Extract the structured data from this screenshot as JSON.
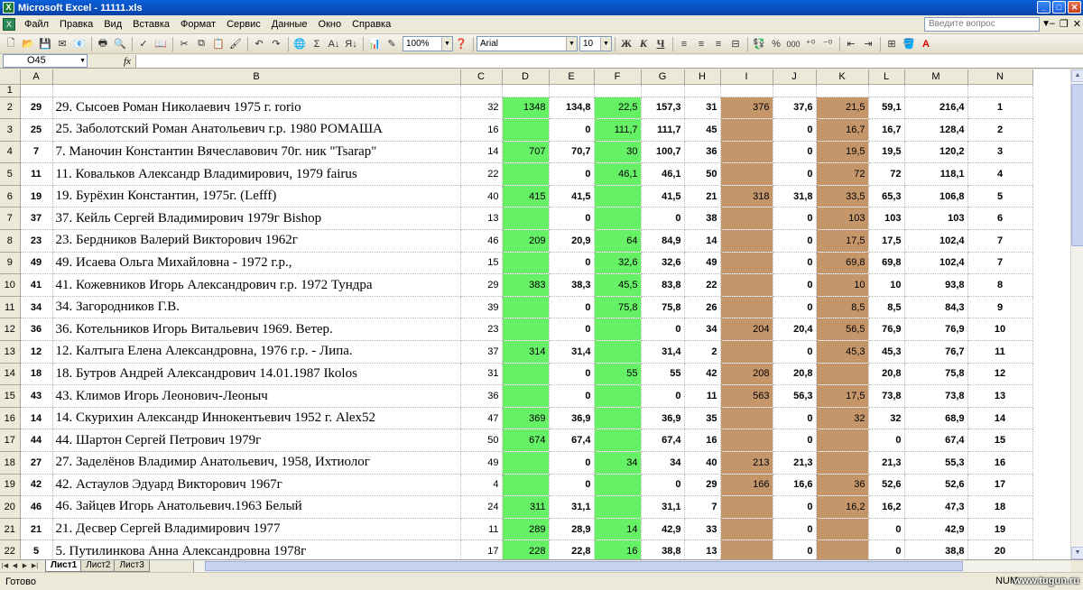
{
  "window": {
    "title": "Microsoft Excel - 11111.xls",
    "app_icon": "X"
  },
  "menu": {
    "items": [
      "Файл",
      "Правка",
      "Вид",
      "Вставка",
      "Формат",
      "Сервис",
      "Данные",
      "Окно",
      "Справка"
    ],
    "help_placeholder": "Введите вопрос"
  },
  "toolbar": {
    "zoom": "100%",
    "font": "Arial",
    "font_size": "10",
    "bold": "Ж",
    "italic": "К",
    "underline": "Ч",
    "percent": "%",
    "thousands": "000",
    "sum": "Σ"
  },
  "formula_bar": {
    "name_box": "O45",
    "fx": "fx",
    "content": ""
  },
  "columns": [
    "A",
    "B",
    "C",
    "D",
    "E",
    "F",
    "G",
    "H",
    "I",
    "J",
    "K",
    "L",
    "M",
    "N"
  ],
  "rows": [
    {
      "n": "1",
      "a": "",
      "b": "",
      "c": "",
      "d": "",
      "e": "",
      "f": "",
      "g": "",
      "h": "",
      "i": "",
      "j": "",
      "k": "",
      "l": "",
      "m": "",
      "nn": ""
    },
    {
      "n": "2",
      "a": "29",
      "b": "29. Сысоев Роман Николаевич 1975 г. rorio",
      "c": "32",
      "d": "1348",
      "e": "134,8",
      "f": "22,5",
      "g": "157,3",
      "h": "31",
      "i": "376",
      "j": "37,6",
      "k": "21,5",
      "l": "59,1",
      "m": "216,4",
      "nn": "1"
    },
    {
      "n": "3",
      "a": "25",
      "b": "25. Заболотский Роман Анатольевич г.р. 1980 РОМАША",
      "c": "16",
      "d": "",
      "e": "0",
      "f": "111,7",
      "g": "111,7",
      "h": "45",
      "i": "",
      "j": "0",
      "k": "16,7",
      "l": "16,7",
      "m": "128,4",
      "nn": "2"
    },
    {
      "n": "4",
      "a": "7",
      "b": "7. Маночин Константин Вячеславович 70г. ник \"Tsarap\"",
      "c": "14",
      "d": "707",
      "e": "70,7",
      "f": "30",
      "g": "100,7",
      "h": "36",
      "i": "",
      "j": "0",
      "k": "19,5",
      "l": "19,5",
      "m": "120,2",
      "nn": "3"
    },
    {
      "n": "5",
      "a": "11",
      "b": "11. Ковальков Александр Владимирович, 1979 fairus",
      "c": "22",
      "d": "",
      "e": "0",
      "f": "46,1",
      "g": "46,1",
      "h": "50",
      "i": "",
      "j": "0",
      "k": "72",
      "l": "72",
      "m": "118,1",
      "nn": "4"
    },
    {
      "n": "6",
      "a": "19",
      "b": "19. Бурёхин Константин, 1975г. (Lefff)",
      "c": "40",
      "d": "415",
      "e": "41,5",
      "f": "",
      "g": "41,5",
      "h": "21",
      "i": "318",
      "j": "31,8",
      "k": "33,5",
      "l": "65,3",
      "m": "106,8",
      "nn": "5"
    },
    {
      "n": "7",
      "a": "37",
      "b": "37. Кейль Сергей Владимирович 1979г Bishop",
      "c": "13",
      "d": "",
      "e": "0",
      "f": "",
      "g": "0",
      "h": "38",
      "i": "",
      "j": "0",
      "k": "103",
      "l": "103",
      "m": "103",
      "nn": "6"
    },
    {
      "n": "8",
      "a": "23",
      "b": "23. Бердников Валерий Викторович 1962г",
      "c": "46",
      "d": "209",
      "e": "20,9",
      "f": "64",
      "g": "84,9",
      "h": "14",
      "i": "",
      "j": "0",
      "k": "17,5",
      "l": "17,5",
      "m": "102,4",
      "nn": "7"
    },
    {
      "n": "9",
      "a": "49",
      "b": "49. Исаева Ольга Михайловна - 1972 г.р.,",
      "c": "15",
      "d": "",
      "e": "0",
      "f": "32,6",
      "g": "32,6",
      "h": "49",
      "i": "",
      "j": "0",
      "k": "69,8",
      "l": "69,8",
      "m": "102,4",
      "nn": "7"
    },
    {
      "n": "10",
      "a": "41",
      "b": "41. Кожевников Игорь Александрович г.р. 1972 Тундра",
      "c": "29",
      "d": "383",
      "e": "38,3",
      "f": "45,5",
      "g": "83,8",
      "h": "22",
      "i": "",
      "j": "0",
      "k": "10",
      "l": "10",
      "m": "93,8",
      "nn": "8"
    },
    {
      "n": "11",
      "a": "34",
      "b": "34. Загородников Г.В.",
      "c": "39",
      "d": "",
      "e": "0",
      "f": "75,8",
      "g": "75,8",
      "h": "26",
      "i": "",
      "j": "0",
      "k": "8,5",
      "l": "8,5",
      "m": "84,3",
      "nn": "9"
    },
    {
      "n": "12",
      "a": "36",
      "b": "36. Котельников Игорь Витальевич 1969. Ветер.",
      "c": "23",
      "d": "",
      "e": "0",
      "f": "",
      "g": "0",
      "h": "34",
      "i": "204",
      "j": "20,4",
      "k": "56,5",
      "l": "76,9",
      "m": "76,9",
      "nn": "10"
    },
    {
      "n": "13",
      "a": "12",
      "b": "12. Калтыга Елена Александровна, 1976 г.р. - Липа.",
      "c": "37",
      "d": "314",
      "e": "31,4",
      "f": "",
      "g": "31,4",
      "h": "2",
      "i": "",
      "j": "0",
      "k": "45,3",
      "l": "45,3",
      "m": "76,7",
      "nn": "11"
    },
    {
      "n": "14",
      "a": "18",
      "b": "18. Бутров Андрей Александрович 14.01.1987 Ikolos",
      "c": "31",
      "d": "",
      "e": "0",
      "f": "55",
      "g": "55",
      "h": "42",
      "i": "208",
      "j": "20,8",
      "k": "",
      "l": "20,8",
      "m": "75,8",
      "nn": "12"
    },
    {
      "n": "15",
      "a": "43",
      "b": "43. Климов Игорь Леонович-Леоныч",
      "c": "36",
      "d": "",
      "e": "0",
      "f": "",
      "g": "0",
      "h": "11",
      "i": "563",
      "j": "56,3",
      "k": "17,5",
      "l": "73,8",
      "m": "73,8",
      "nn": "13"
    },
    {
      "n": "16",
      "a": "14",
      "b": "14. Скурихин Александр Иннокентьевич 1952 г. Alex52",
      "c": "47",
      "d": "369",
      "e": "36,9",
      "f": "",
      "g": "36,9",
      "h": "35",
      "i": "",
      "j": "0",
      "k": "32",
      "l": "32",
      "m": "68,9",
      "nn": "14"
    },
    {
      "n": "17",
      "a": "44",
      "b": "44. Шартон Сергей Петрович 1979г",
      "c": "50",
      "d": "674",
      "e": "67,4",
      "f": "",
      "g": "67,4",
      "h": "16",
      "i": "",
      "j": "0",
      "k": "",
      "l": "0",
      "m": "67,4",
      "nn": "15"
    },
    {
      "n": "18",
      "a": "27",
      "b": "27. Заделёнов Владимир Анатольевич, 1958, Ихтиолог",
      "c": "49",
      "d": "",
      "e": "0",
      "f": "34",
      "g": "34",
      "h": "40",
      "i": "213",
      "j": "21,3",
      "k": "",
      "l": "21,3",
      "m": "55,3",
      "nn": "16"
    },
    {
      "n": "19",
      "a": "42",
      "b": "42. Астаулов Эдуард Викторович 1967г",
      "c": "4",
      "d": "",
      "e": "0",
      "f": "",
      "g": "0",
      "h": "29",
      "i": "166",
      "j": "16,6",
      "k": "36",
      "l": "52,6",
      "m": "52,6",
      "nn": "17"
    },
    {
      "n": "20",
      "a": "46",
      "b": "46. Зайцев Игорь Анатольевич.1963 Белый",
      "c": "24",
      "d": "311",
      "e": "31,1",
      "f": "",
      "g": "31,1",
      "h": "7",
      "i": "",
      "j": "0",
      "k": "16,2",
      "l": "16,2",
      "m": "47,3",
      "nn": "18"
    },
    {
      "n": "21",
      "a": "21",
      "b": "21. Десвер Сергей Владимирович 1977",
      "c": "11",
      "d": "289",
      "e": "28,9",
      "f": "14",
      "g": "42,9",
      "h": "33",
      "i": "",
      "j": "0",
      "k": "",
      "l": "0",
      "m": "42,9",
      "nn": "19"
    },
    {
      "n": "22",
      "a": "5",
      "b": "5. Путилинкова Анна Александровна 1978г",
      "c": "17",
      "d": "228",
      "e": "22,8",
      "f": "16",
      "g": "38,8",
      "h": "13",
      "i": "",
      "j": "0",
      "k": "",
      "l": "0",
      "m": "38,8",
      "nn": "20"
    }
  ],
  "sheet_tabs": [
    "Лист1",
    "Лист2",
    "Лист3"
  ],
  "status": {
    "ready": "Готово",
    "num": "NUM",
    "watermark": "www.tugun.ru"
  },
  "colors": {
    "green_fill": "#66f066",
    "brown_fill": "#c6966b",
    "title_bar": "#0a5fd8"
  }
}
